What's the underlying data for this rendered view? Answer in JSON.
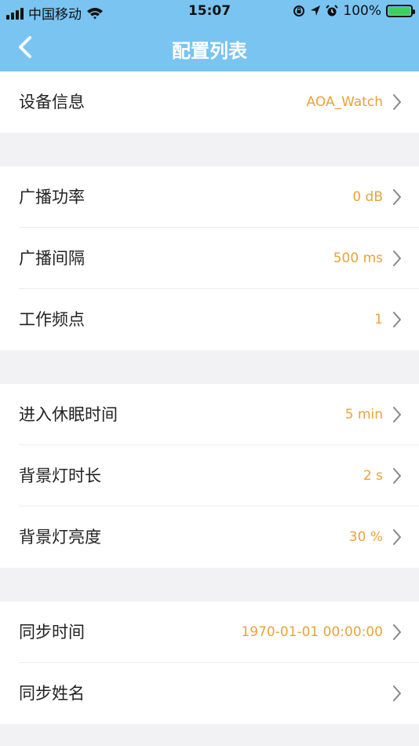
{
  "status_bar": {
    "carrier": "中国移动",
    "time": "15:07",
    "battery_percent": "100%",
    "icons": [
      "signal-icon",
      "wifi-icon",
      "rotation-lock-icon",
      "location-icon",
      "alarm-icon",
      "battery-icon"
    ]
  },
  "nav": {
    "title": "配置列表",
    "back_icon": "chevron-left-icon"
  },
  "colors": {
    "nav_bg": "#79c4f1",
    "value_text": "#e9a23b",
    "page_bg": "#f2f2f4"
  },
  "groups": [
    {
      "rows": [
        {
          "label": "设备信息",
          "value": "AOA_Watch"
        }
      ]
    },
    {
      "rows": [
        {
          "label": "广播功率",
          "value": "0 dB"
        },
        {
          "label": "广播间隔",
          "value": "500 ms"
        },
        {
          "label": "工作频点",
          "value": "1"
        }
      ]
    },
    {
      "rows": [
        {
          "label": "进入休眠时间",
          "value": "5 min"
        },
        {
          "label": "背景灯时长",
          "value": "2 s"
        },
        {
          "label": "背景灯亮度",
          "value": "30 %"
        }
      ]
    },
    {
      "rows": [
        {
          "label": "同步时间",
          "value": "1970-01-01 00:00:00"
        },
        {
          "label": "同步姓名",
          "value": ""
        }
      ]
    }
  ]
}
